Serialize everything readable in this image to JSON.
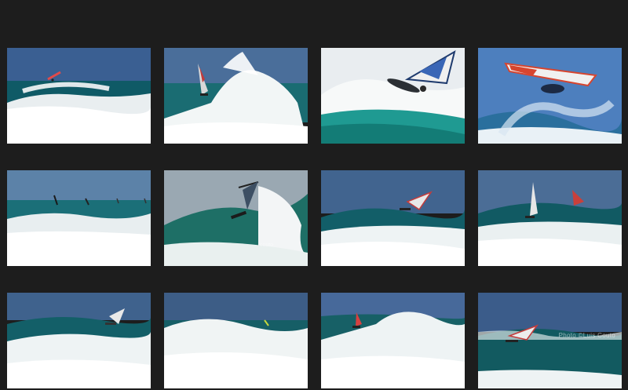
{
  "gallery": {
    "watermark_text": "Photo ©Luis Couto",
    "watermark_short": "couto",
    "photos": [
      {
        "scene": "wave-break",
        "sky": "#3a5f92",
        "sea": "#0f5a66"
      },
      {
        "scene": "spray-jump",
        "sky": "#4a6e9a",
        "sea": "#1a6c72"
      },
      {
        "scene": "aerial-closeup",
        "sky": "#e9edf0",
        "sea": "#1f9a92"
      },
      {
        "scene": "sky-jump",
        "sky": "#4d7fbe",
        "sea": "#2a6f9d"
      },
      {
        "scene": "multi-sails",
        "sky": "#5c82a8",
        "sea": "#1b6f78"
      },
      {
        "scene": "wave-ride",
        "sky": "#9aa8b2",
        "sea": "#1e6f66"
      },
      {
        "scene": "wave-break",
        "sky": "#41648f",
        "sea": "#125e68"
      },
      {
        "scene": "wave-break",
        "sky": "#4b6d96",
        "sea": "#115a63"
      },
      {
        "scene": "wave-ride",
        "sky": "#3f628d",
        "sea": "#135f68"
      },
      {
        "scene": "wave-break",
        "sky": "#3d5d86",
        "sea": "#165e66"
      },
      {
        "scene": "wave-break",
        "sky": "#47699a",
        "sea": "#176066"
      },
      {
        "scene": "wave-ride",
        "sky": "#3b5c8a",
        "sea": "#125a60"
      }
    ]
  }
}
